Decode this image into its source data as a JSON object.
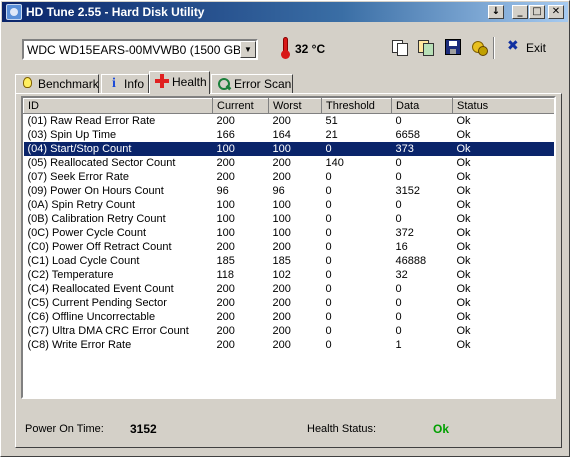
{
  "window": {
    "title": "HD Tune 2.55 - Hard Disk Utility",
    "btn_help": "↓",
    "btn_minimize": "_",
    "btn_maximize": "□",
    "btn_close": "✕"
  },
  "toolbar": {
    "drive": "WDC WD15EARS-00MVWB0 (1500 GB)",
    "temperature": "32 °C",
    "exit_label": "Exit"
  },
  "tabs": [
    {
      "label": "Benchmark",
      "icon": "bulb-icon"
    },
    {
      "label": "Info",
      "icon": "info-icon"
    },
    {
      "label": "Health",
      "icon": "health-cross-icon",
      "active": true
    },
    {
      "label": "Error Scan",
      "icon": "scan-icon"
    }
  ],
  "health_table": {
    "columns": [
      "ID",
      "Current",
      "Worst",
      "Threshold",
      "Data",
      "Status"
    ],
    "rows": [
      [
        "(01) Raw Read Error Rate",
        "200",
        "200",
        "51",
        "0",
        "Ok"
      ],
      [
        "(03) Spin Up Time",
        "166",
        "164",
        "21",
        "6658",
        "Ok"
      ],
      [
        "(04) Start/Stop Count",
        "100",
        "100",
        "0",
        "373",
        "Ok"
      ],
      [
        "(05) Reallocated Sector Count",
        "200",
        "200",
        "140",
        "0",
        "Ok"
      ],
      [
        "(07) Seek Error Rate",
        "200",
        "200",
        "0",
        "0",
        "Ok"
      ],
      [
        "(09) Power On Hours Count",
        "96",
        "96",
        "0",
        "3152",
        "Ok"
      ],
      [
        "(0A) Spin Retry Count",
        "100",
        "100",
        "0",
        "0",
        "Ok"
      ],
      [
        "(0B) Calibration Retry Count",
        "100",
        "100",
        "0",
        "0",
        "Ok"
      ],
      [
        "(0C) Power Cycle Count",
        "100",
        "100",
        "0",
        "372",
        "Ok"
      ],
      [
        "(C0) Power Off Retract Count",
        "200",
        "200",
        "0",
        "16",
        "Ok"
      ],
      [
        "(C1) Load Cycle Count",
        "185",
        "185",
        "0",
        "46888",
        "Ok"
      ],
      [
        "(C2) Temperature",
        "118",
        "102",
        "0",
        "32",
        "Ok"
      ],
      [
        "(C4) Reallocated Event Count",
        "200",
        "200",
        "0",
        "0",
        "Ok"
      ],
      [
        "(C5) Current Pending Sector",
        "200",
        "200",
        "0",
        "0",
        "Ok"
      ],
      [
        "(C6) Offline Uncorrectable",
        "200",
        "200",
        "0",
        "0",
        "Ok"
      ],
      [
        "(C7) Ultra DMA CRC Error Count",
        "200",
        "200",
        "0",
        "0",
        "Ok"
      ],
      [
        "(C8) Write Error Rate",
        "200",
        "200",
        "0",
        "1",
        "Ok"
      ]
    ],
    "selected_row": 2
  },
  "footer": {
    "power_on_label": "Power On Time:",
    "power_on_value": "3152",
    "health_label": "Health Status:",
    "health_value": "Ok"
  },
  "colors": {
    "selection": "#0a246a",
    "status_ok": "#00a000",
    "title_gradient_start": "#0a246a"
  }
}
